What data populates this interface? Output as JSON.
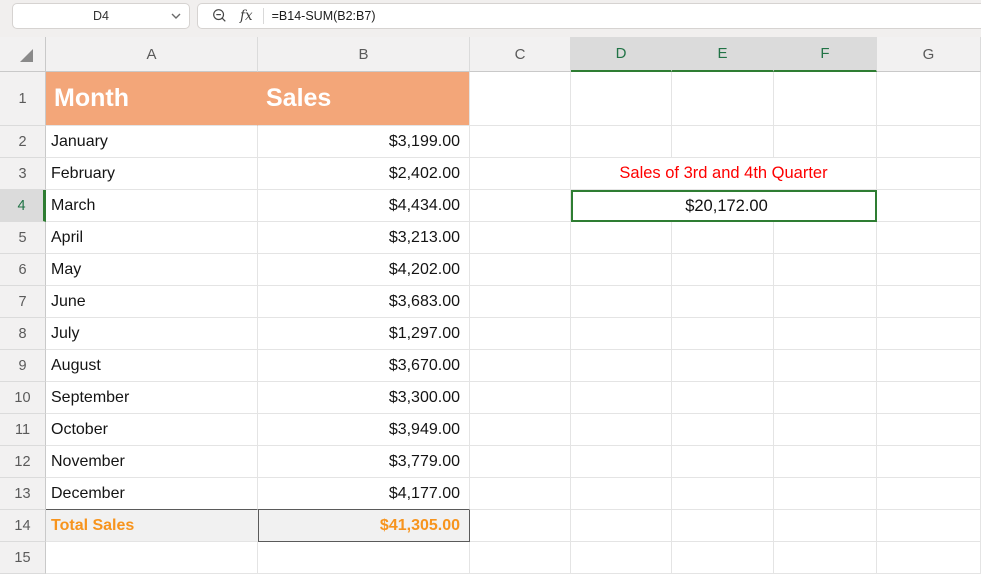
{
  "formula_bar": {
    "cell_reference": "D4",
    "fx_label": "fx",
    "formula": "=B14-SUM(B2:B7)"
  },
  "sheet": {
    "column_headers": [
      "A",
      "B",
      "C",
      "D",
      "E",
      "F",
      "G"
    ],
    "selected_columns": [
      "D",
      "E",
      "F"
    ],
    "row_headers": [
      "1",
      "2",
      "3",
      "4",
      "5",
      "6",
      "7",
      "8",
      "9",
      "10",
      "11",
      "12",
      "13",
      "14",
      "15"
    ],
    "selected_row": "4"
  },
  "table": {
    "headers": {
      "month": "Month",
      "sales": "Sales"
    },
    "rows": [
      {
        "month": "January",
        "sales": "$3,199.00"
      },
      {
        "month": "February",
        "sales": "$2,402.00"
      },
      {
        "month": "March",
        "sales": "$4,434.00"
      },
      {
        "month": "April",
        "sales": "$3,213.00"
      },
      {
        "month": "May",
        "sales": "$4,202.00"
      },
      {
        "month": "June",
        "sales": "$3,683.00"
      },
      {
        "month": "July",
        "sales": "$1,297.00"
      },
      {
        "month": "August",
        "sales": "$3,670.00"
      },
      {
        "month": "September",
        "sales": "$3,300.00"
      },
      {
        "month": "October",
        "sales": "$3,949.00"
      },
      {
        "month": "November",
        "sales": "$3,779.00"
      },
      {
        "month": "December",
        "sales": "$4,177.00"
      }
    ],
    "total": {
      "label": "Total Sales",
      "value": "$41,305.00"
    }
  },
  "annotation": {
    "title": "Sales of 3rd and 4th Quarter",
    "value": "$20,172.00"
  },
  "colors": {
    "title_row_fill": "#F3A679",
    "title_row_text": "#FFFFFF",
    "total_text": "#F7941D",
    "annotation_text": "#FE0000",
    "selection_border_green": "#2E7D32",
    "header_highlight_green": "#217346",
    "header_highlight_fill": "#DBDBDB"
  }
}
